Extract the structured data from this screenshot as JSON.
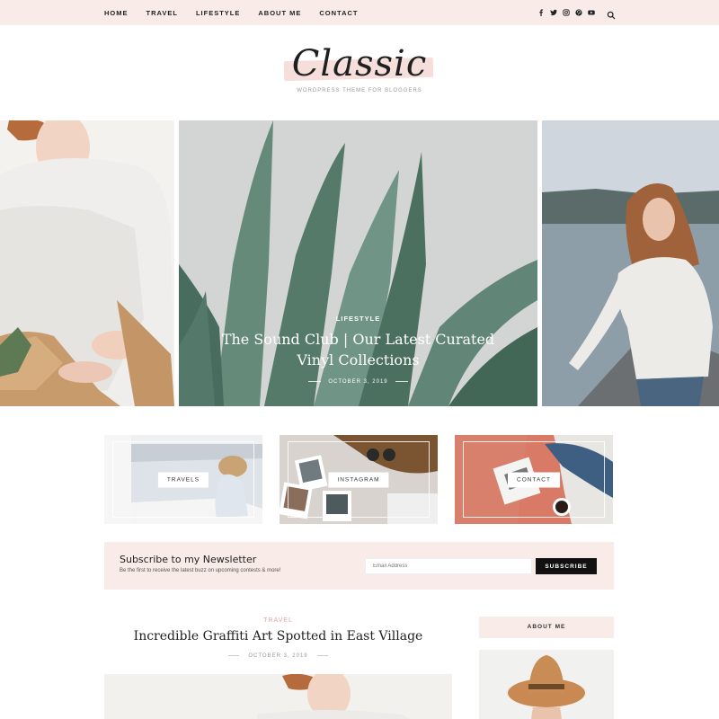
{
  "nav": {
    "items": [
      "HOME",
      "TRAVEL",
      "LIFESTYLE",
      "ABOUT ME",
      "CONTACT"
    ],
    "social_icons": [
      "facebook-icon",
      "twitter-icon",
      "instagram-icon",
      "pinterest-icon",
      "youtube-icon"
    ],
    "search_icon": "search-icon"
  },
  "logo": {
    "text": "Classic",
    "tagline": "WORDPRESS THEME FOR BLOGGERS"
  },
  "slider": {
    "category": "LIFESTYLE",
    "title": "The Sound Club | Our Latest Curated Vinyl Collections",
    "date": "OCTOBER 3, 2019"
  },
  "categories": [
    "TRAVELS",
    "INSTAGRAM",
    "CONTACT"
  ],
  "newsletter": {
    "title": "Subscribe to my Newsletter",
    "subtitle": "Be the first to receive the latest buzz on upcoming contests & more!",
    "placeholder": "Email Address",
    "button": "SUBSCRIBE"
  },
  "post": {
    "category": "TRAVEL",
    "title": "Incredible Graffiti Art Spotted in East Village",
    "date": "OCTOBER 3, 2019"
  },
  "sidebar": {
    "heading": "ABOUT ME"
  },
  "colors": {
    "blush": "#f8ebe8",
    "accent": "#d9a6a0",
    "dark": "#111111"
  }
}
